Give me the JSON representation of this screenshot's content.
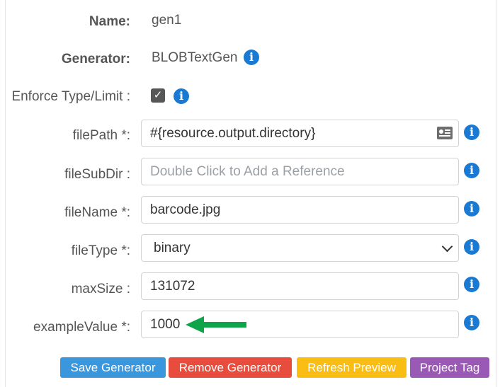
{
  "fields": {
    "name": {
      "label": "Name:",
      "value": "gen1"
    },
    "generator": {
      "label": "Generator:",
      "value": "BLOBTextGen"
    },
    "enforce": {
      "label": "Enforce Type/Limit :",
      "checked": true
    },
    "filePath": {
      "label": "filePath *:",
      "value": "#{resource.output.directory}"
    },
    "fileSubDir": {
      "label": "fileSubDir :",
      "value": "",
      "placeholder": "Double Click to Add a Reference"
    },
    "fileName": {
      "label": "fileName *:",
      "value": "barcode.jpg"
    },
    "fileType": {
      "label": "fileType *:",
      "value": "binary"
    },
    "maxSize": {
      "label": "maxSize :",
      "value": "131072"
    },
    "exampleValue": {
      "label": "exampleValue *:",
      "value": "1000"
    }
  },
  "icons": {
    "info": "info-circle-icon",
    "reference": "id-card-icon",
    "dropdown": "chevron-down-icon",
    "annotation": "green-arrow-left-icon"
  },
  "info_glyph": "i",
  "buttons": [
    {
      "label": "Save Generator",
      "color": "#3a96dd"
    },
    {
      "label": "Remove Generator",
      "color": "#e84c3d"
    },
    {
      "label": "Refresh Preview",
      "color": "#f9bd13"
    },
    {
      "label": "Project Tag",
      "color": "#9b59b6"
    }
  ],
  "colors": {
    "info": "#1a7ad3",
    "arrow": "#0ea44a"
  }
}
